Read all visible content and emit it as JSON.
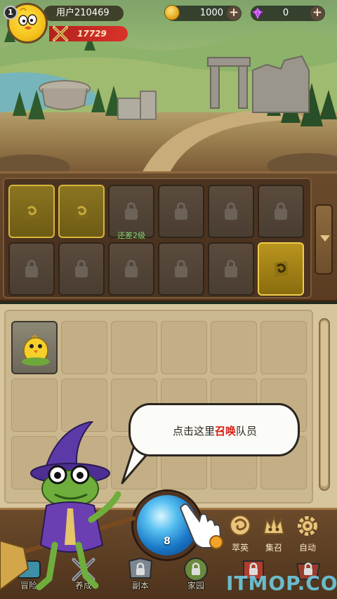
{
  "player": {
    "level": "1",
    "name": "用户210469",
    "power": "17729"
  },
  "resources": {
    "gold": "1000",
    "gems": "0"
  },
  "equipment": {
    "unlock_hint": "还差2级"
  },
  "tutorial": {
    "prefix": "点击这里",
    "highlight": "召唤",
    "suffix": "队员"
  },
  "summon": {
    "count": "8"
  },
  "functions": [
    {
      "label": "萃英"
    },
    {
      "label": "集召"
    },
    {
      "label": "自动"
    }
  ],
  "nav": [
    {
      "label": "冒险"
    },
    {
      "label": "养成"
    },
    {
      "label": "副本"
    },
    {
      "label": "家园"
    },
    {
      "label": ""
    },
    {
      "label": ""
    }
  ],
  "watermark": "ITMOP.COM",
  "colors": {
    "power_banner": "#d9332a",
    "hint_green": "#7fd66a",
    "highlight_red": "#d81e16",
    "gold_slot": "#d8b53a"
  }
}
